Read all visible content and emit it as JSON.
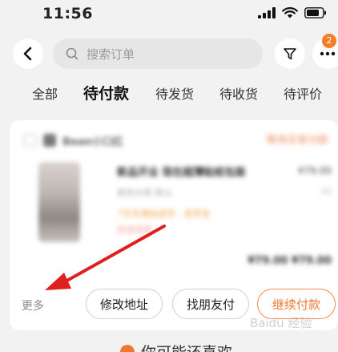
{
  "status_bar": {
    "time": "11:56"
  },
  "header": {
    "search_placeholder": "搜索订单",
    "more_badge": "2"
  },
  "tabs": [
    {
      "label": "全部",
      "active": false
    },
    {
      "label": "待付款",
      "active": true
    },
    {
      "label": "待发货",
      "active": false
    },
    {
      "label": "待收货",
      "active": false
    },
    {
      "label": "待评价",
      "active": false
    }
  ],
  "order_card": {
    "shop_name": "Bean小口红",
    "status": "等待买家付款",
    "product_title": "新品开业 现在超薄贴纸包装",
    "product_spec": "颜色分类 默认",
    "product_tags": "7天无理由退货 · 退货宝",
    "product_note": "极速退款",
    "unit_price": "¥79.00",
    "quantity": "x1",
    "total": "¥79.00 ¥79.00",
    "more_label": "更多",
    "actions": {
      "modify_address": "修改地址",
      "ask_friend_pay": "找朋友付",
      "continue_pay": "继续付款"
    }
  },
  "recommend": {
    "label": "你可能还喜欢"
  },
  "watermark": "Baidu 经验",
  "colors": {
    "accent": "#f07830",
    "badge": "#f57c2b",
    "annotation_arrow": "#e02020",
    "background": "#f2f2f2"
  }
}
